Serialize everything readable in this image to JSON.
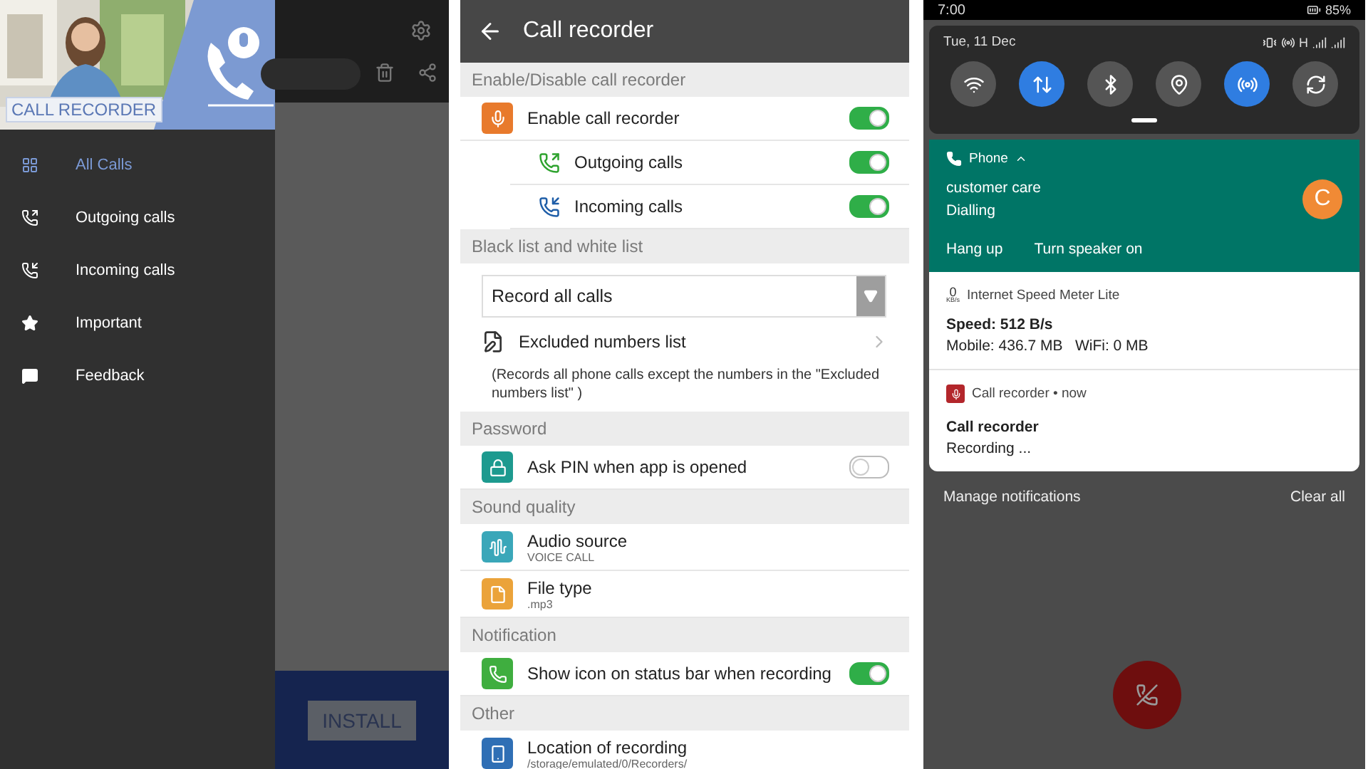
{
  "drawer_screen": {
    "header_label": "CALL RECORDER",
    "menu": [
      {
        "label": "All Calls",
        "selected": true
      },
      {
        "label": "Outgoing calls",
        "selected": false
      },
      {
        "label": "Incoming calls",
        "selected": false
      },
      {
        "label": "Important",
        "selected": false
      },
      {
        "label": "Feedback",
        "selected": false
      }
    ],
    "install_button": "INSTALL"
  },
  "settings_screen": {
    "title": "Call recorder",
    "sections": [
      {
        "title": "Enable/Disable call recorder",
        "items": [
          {
            "kind": "toggle",
            "label": "Enable call recorder",
            "on": true,
            "children": [
              {
                "kind": "toggle",
                "label": "Outgoing calls",
                "on": true
              },
              {
                "kind": "toggle",
                "label": "Incoming calls",
                "on": true
              }
            ]
          }
        ]
      },
      {
        "title": "Black list and white list",
        "items": [
          {
            "kind": "select",
            "value": "Record all calls"
          },
          {
            "kind": "link",
            "label": "Excluded numbers list"
          },
          {
            "kind": "note",
            "text": "(Records all phone calls except the numbers in the \"Excluded numbers list\" )"
          }
        ]
      },
      {
        "title": "Password",
        "items": [
          {
            "kind": "toggle",
            "label": "Ask PIN when app is opened",
            "on": false
          }
        ]
      },
      {
        "title": "Sound quality",
        "items": [
          {
            "kind": "value",
            "label": "Audio source",
            "value": "VOICE CALL"
          },
          {
            "kind": "value",
            "label": "File type",
            "value": ".mp3"
          }
        ]
      },
      {
        "title": "Notification",
        "items": [
          {
            "kind": "toggle",
            "label": "Show icon on status bar when recording",
            "on": true
          }
        ]
      },
      {
        "title": "Other",
        "items": [
          {
            "kind": "value",
            "label": "Location of recording",
            "value": "/storage/emulated/0/Recorders/"
          }
        ]
      }
    ]
  },
  "notification_shade": {
    "time": "7:00",
    "battery": "85%",
    "date": "Tue, 11 Dec",
    "network": "H",
    "tiles": [
      {
        "on": false
      },
      {
        "on": true
      },
      {
        "on": false
      },
      {
        "on": false
      },
      {
        "on": true
      },
      {
        "on": false
      }
    ],
    "notifications": [
      {
        "kind": "call",
        "app": "Phone",
        "title": "customer care",
        "text": "Dialling",
        "avatar": "C",
        "actions": [
          "Hang up",
          "Turn speaker on"
        ]
      },
      {
        "kind": "speed",
        "badge": "0",
        "badge_unit": "KB/s",
        "app": "Internet Speed Meter Lite",
        "title": "Speed: 512 B/s",
        "text": "Mobile: 436.7 MB   WiFi: 0 MB"
      },
      {
        "kind": "recorder",
        "app": "Call recorder • now",
        "title": "Call recorder",
        "text": "Recording ..."
      }
    ],
    "manage": "Manage notifications",
    "clear": "Clear all"
  }
}
